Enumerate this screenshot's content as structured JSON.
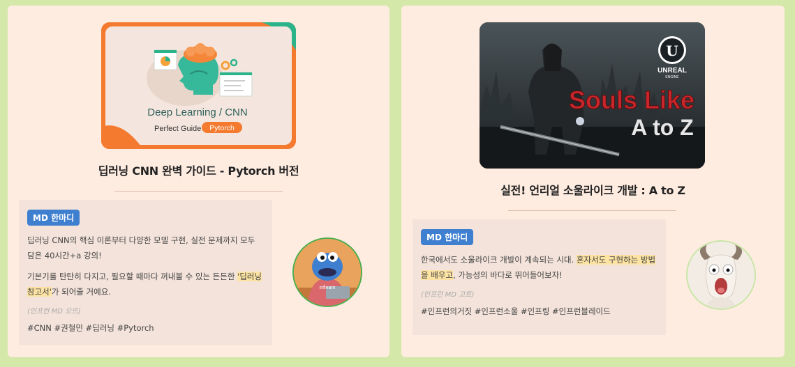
{
  "cards": [
    {
      "thumb": {
        "line1": "Deep Learning / CNN",
        "line2": "Perfect Guide",
        "pill": "Pytorch"
      },
      "title": "딥러닝 CNN 완벽 가이드 - Pytorch 버전",
      "md": {
        "badge": "MD 한마디",
        "p1": "딥러닝 CNN의 핵심 이론부터 다양한 모델 구현, 실전 문제까지 모두 담은 40시간+a 강의!",
        "p2_pre": "기본기를 탄탄히 다지고, 필요할 때마다 꺼내볼 수 있는 든든한 ",
        "p2_hl": "'딥러닝 참고서'",
        "p2_post": "가 되어줄 거예요.",
        "author": "(인프런 MD 오뜨)",
        "tags": "#CNN #권철민 #딥러닝 #Pytorch"
      },
      "avatar_icon": "cookie-monster-avatar",
      "avatar_label": "inflearn"
    },
    {
      "thumb": {
        "engine_top": "UNREAL",
        "engine_bottom": "ENGINE",
        "line1": "Souls Like",
        "line2": "A to Z"
      },
      "title": "실전! 언리얼 소울라이크 개발 : A to Z",
      "md": {
        "badge": "MD 한마디",
        "p1_pre": "한국에서도 소울라이크 개발이 계속되는 시대. ",
        "p1_hl": "혼자서도 구현하는 방법을 배우고",
        "p1_post": ", 가능성의 바다로 뛰어들어보자!",
        "author": "(인프런 MD 고트)",
        "tags": "#인프런의거짓 #인프런소울 #인프링 #인프런블레이드"
      },
      "avatar_icon": "screaming-goat-avatar"
    }
  ],
  "colors": {
    "page_bg": "#d3e8a9",
    "card_bg": "#ffece1",
    "md_box_bg": "#f3e3da",
    "badge_bg": "#3f7fd0",
    "highlight": "#fde3a3",
    "accent_green": "#2bb48a",
    "accent_orange": "#f47a2f",
    "souls_red": "#c8262a"
  }
}
